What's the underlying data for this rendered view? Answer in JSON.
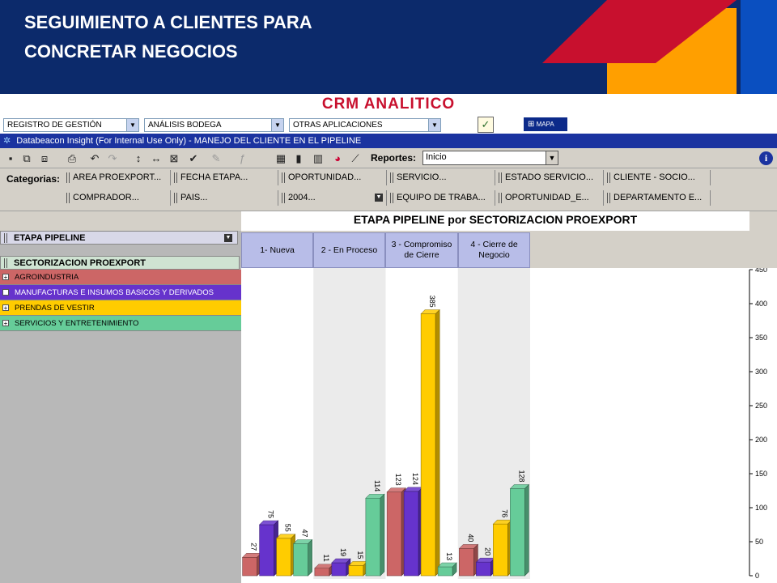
{
  "slide": {
    "title_line1": "SEGUIMIENTO A CLIENTES PARA",
    "title_line2": "CONCRETAR NEGOCIOS",
    "subtitle": "CRM ANALITICO",
    "colors": {
      "navy": "#0c2a6b",
      "red": "#c8102e",
      "orange": "#ff9f00",
      "blue": "#0a4fc0"
    }
  },
  "topnav": {
    "selects": [
      "REGISTRO DE GESTIÓN",
      "ANÁLISIS BODEGA",
      "OTRAS APLICACIONES"
    ],
    "mapa_label": "MAPA"
  },
  "window": {
    "title": "Databeacon Insight (For Internal Use Only) - MANEJO DEL CLIENTE EN EL PIPELINE"
  },
  "toolbar": {
    "reportes_label": "Reportes:",
    "reportes_value": "Inicio"
  },
  "categories": {
    "label": "Categorias:",
    "row1": [
      "AREA PROEXPORT...",
      "FECHA ETAPA...",
      "OPORTUNIDAD...",
      "SERVICIO...",
      "ESTADO SERVICIO...",
      "CLIENTE - SOCIO..."
    ],
    "row2": [
      "COMPRADOR...",
      "PAIS...",
      "2004...",
      "EQUIPO DE TRABA...",
      "OPORTUNIDAD_E...",
      "DEPARTAMENTO E..."
    ]
  },
  "left_panel": {
    "dim1": "ETAPA PIPELINE",
    "dim2": "SECTORIZACION PROEXPORT",
    "segments": [
      {
        "label": "AGROINDUSTRIA",
        "color": "#cc6666"
      },
      {
        "label": "MANUFACTURAS E INSUMOS BASICOS Y DERIVADOS",
        "color": "#6633cc"
      },
      {
        "label": "PRENDAS DE VESTIR",
        "color": "#ffcc00"
      },
      {
        "label": "SERVICIOS Y ENTRETENIMIENTO",
        "color": "#66cc99"
      }
    ]
  },
  "chart_data": {
    "type": "bar",
    "title": "ETAPA PIPELINE por SECTORIZACION PROEXPORT",
    "categories": [
      "1- Nueva",
      "2 - En Proceso",
      "3 - Compromiso de Cierre",
      "4 - Cierre de Negocio"
    ],
    "series": [
      {
        "name": "AGROINDUSTRIA",
        "color": "#cc6666",
        "values": [
          27,
          11,
          123,
          40
        ]
      },
      {
        "name": "MANUFACTURAS E INSUMOS BASICOS Y DERIVADOS",
        "color": "#6633cc",
        "values": [
          75,
          19,
          124,
          20
        ]
      },
      {
        "name": "PRENDAS DE VESTIR",
        "color": "#ffcc00",
        "values": [
          55,
          15,
          385,
          76
        ]
      },
      {
        "name": "SERVICIOS Y ENTRETENIMIENTO",
        "color": "#66cc99",
        "values": [
          47,
          114,
          13,
          128
        ]
      }
    ],
    "ylim": [
      0,
      450
    ],
    "yticks": [
      0,
      50,
      100,
      150,
      200,
      250,
      300,
      350,
      400,
      450
    ],
    "y_axis_side": "right",
    "legend": "left-panel"
  }
}
